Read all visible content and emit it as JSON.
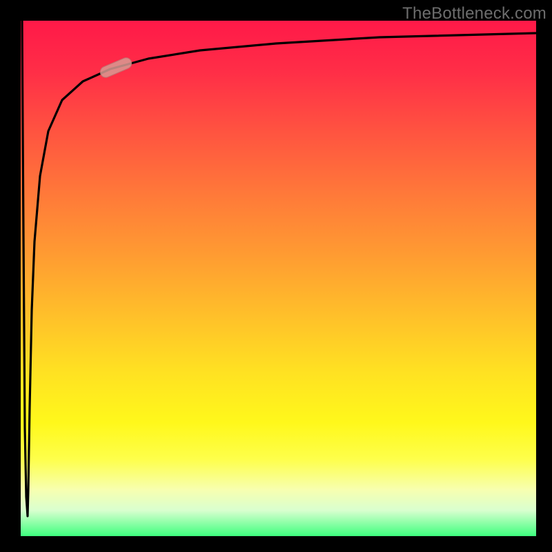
{
  "watermark": "TheBottleneck.com",
  "colors": {
    "frame": "#000000",
    "curve": "#000000",
    "marker_fill": "#d99a93",
    "marker_stroke": "#b97a74",
    "gradient_top": "#ff1948",
    "gradient_mid": "#ffe122",
    "gradient_bottom": "#3eff7e"
  },
  "chart_data": {
    "type": "line",
    "title": "",
    "xlabel": "",
    "ylabel": "",
    "xlim": [
      0,
      100
    ],
    "ylim": [
      0,
      100
    ],
    "grid": false,
    "legend": false,
    "series": [
      {
        "name": "curve",
        "x": [
          0,
          0.5,
          1,
          1.5,
          2,
          3,
          5,
          8,
          12,
          18,
          25,
          35,
          50,
          70,
          100
        ],
        "values": [
          100,
          30,
          5,
          40,
          62,
          75,
          82,
          86,
          88,
          90,
          92,
          93.5,
          95,
          96,
          97
        ]
      }
    ],
    "marker": {
      "x": 18,
      "y": 90
    }
  }
}
